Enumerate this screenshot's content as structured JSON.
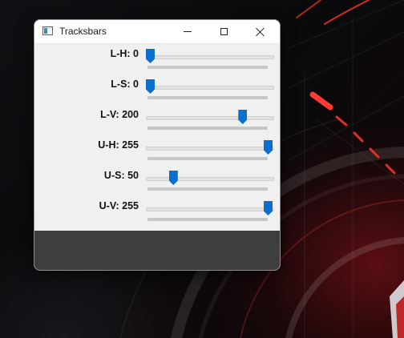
{
  "window": {
    "title": "Tracksbars"
  },
  "trackbars": [
    {
      "id": "l-h",
      "label": "L-H: 0",
      "value": 0,
      "max": 255
    },
    {
      "id": "l-s",
      "label": "L-S: 0",
      "value": 0,
      "max": 255
    },
    {
      "id": "l-v",
      "label": "L-V: 200",
      "value": 200,
      "max": 255
    },
    {
      "id": "u-h",
      "label": "U-H: 255",
      "value": 255,
      "max": 255
    },
    {
      "id": "u-s",
      "label": "U-S: 50",
      "value": 50,
      "max": 255
    },
    {
      "id": "u-v",
      "label": "U-V: 255",
      "value": 255,
      "max": 255
    }
  ],
  "icons": {
    "app": "opencv-window-icon",
    "minimize": "minimize-icon",
    "maximize": "maximize-icon",
    "close": "close-icon"
  },
  "colors": {
    "thumb": "#0b6fcf",
    "panel": "#f0f0f0",
    "image_area": "#3e3e3e"
  }
}
